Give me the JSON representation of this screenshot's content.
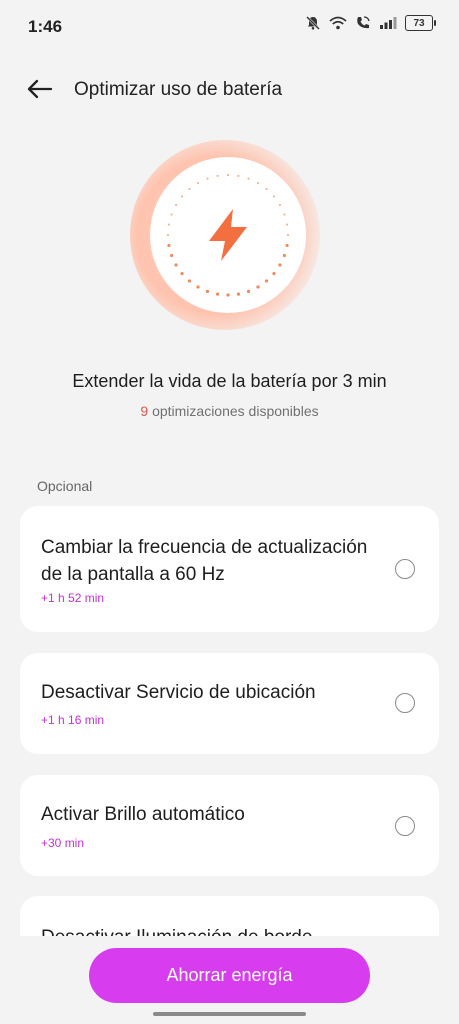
{
  "status": {
    "time": "1:46",
    "battery": "73",
    "icons": [
      "bell-off-icon",
      "wifi-icon",
      "wifi-call-icon",
      "signal-icon",
      "battery-icon"
    ]
  },
  "header": {
    "title": "Optimizar uso de batería",
    "back_icon": "arrow-left-icon"
  },
  "hero": {
    "icon": "lightning-bolt-icon",
    "title": "Extender la vida de la batería por 3 min",
    "count": "9",
    "subtitle": "optimizaciones disponibles"
  },
  "section": {
    "label": "Opcional"
  },
  "items": [
    {
      "title": "Cambiar la frecuencia de actualización de la pantalla a 60 Hz",
      "gain": "+1 h 52 min"
    },
    {
      "title": "Desactivar Servicio de ubicación",
      "gain": "+1 h 16 min"
    },
    {
      "title": "Activar Brillo automático",
      "gain": "+30 min"
    },
    {
      "title": "Desactivar Iluminación de borde"
    }
  ],
  "action": {
    "label": "Ahorrar energía"
  },
  "colors": {
    "accent": "#d73cef",
    "gain": "#c530d6",
    "bolt": "#f36f3f",
    "count": "#e05353"
  }
}
